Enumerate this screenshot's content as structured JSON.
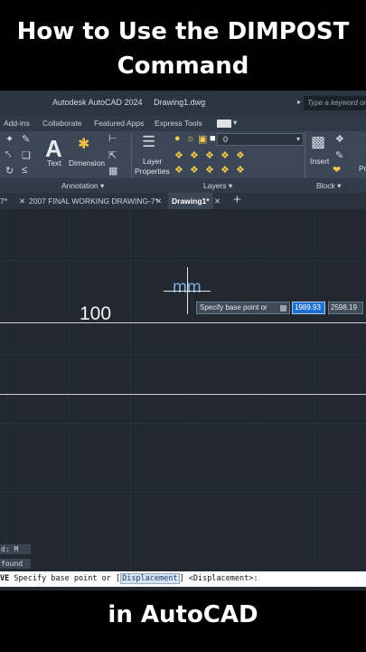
{
  "headline": {
    "top": "How to Use the DIMPOST Command",
    "bottom": "in AutoCAD"
  },
  "titlebar": {
    "app_name": "Autodesk AutoCAD 2024",
    "file_name": "Drawing1.dwg",
    "search_placeholder": "Type a keyword or phrase"
  },
  "ribbon_tabs": [
    "Add-ins",
    "Collaborate",
    "Featured Apps",
    "Express Tools"
  ],
  "ribbon": {
    "text_label": "Text",
    "dimension_label": "Dimension",
    "layer_properties_label": [
      "Layer",
      "Properties"
    ],
    "layer_value": "0",
    "insert_label": "Insert",
    "extra_label": "Pr"
  },
  "panels": {
    "annotation": "Annotation ▾",
    "layers": "Layers ▾",
    "block": "Block ▾"
  },
  "document_tabs": [
    {
      "label": "7*"
    },
    {
      "label": "2007 FINAL WORKING DRAWING-7*"
    },
    {
      "label": "Drawing1*"
    }
  ],
  "canvas": {
    "dimension_value": "100",
    "suffix_text": "mm",
    "tooltip": "Specify base point or",
    "coord_x": "1989.93",
    "coord_y": "2598.19"
  },
  "history": [
    "d: M",
    "found"
  ],
  "command": {
    "prefix": "VE",
    "text_before": "Specify base point or [",
    "option": "Displacement",
    "text_after": "] <Displacement>:"
  },
  "colors": {
    "accent": "#1f6fd1",
    "suffix": "#7fa9d8"
  }
}
